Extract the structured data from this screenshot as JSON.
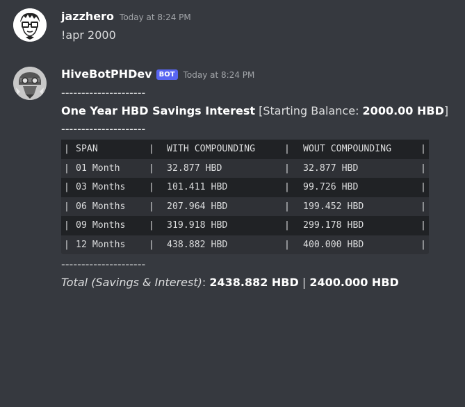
{
  "messages": [
    {
      "username": "jazzhero",
      "timestamp": "Today at 8:24 PM",
      "text": "!apr 2000"
    },
    {
      "username": "HiveBotPHDev",
      "bot_tag": "BOT",
      "timestamp": "Today at 8:24 PM",
      "divider": "---------------------",
      "title_bold": "One Year HBD Savings Interest",
      "title_rest": " [Starting Balance: ",
      "title_balance": "2000.00 HBD",
      "title_close": "]",
      "table": {
        "pipe": "|",
        "headers": [
          "SPAN",
          "WITH COMPOUNDING",
          "WOUT COMPOUNDING"
        ],
        "rows": [
          [
            "01 Month",
            "32.877 HBD",
            "32.877 HBD"
          ],
          [
            "03 Months",
            "101.411 HBD",
            "99.726 HBD"
          ],
          [
            "06 Months",
            "207.964 HBD",
            "199.452 HBD"
          ],
          [
            "09 Months",
            "319.918 HBD",
            "299.178 HBD"
          ],
          [
            "12 Months",
            "438.882 HBD",
            "400.000 HBD"
          ]
        ]
      },
      "total_label": "Total (Savings & Interest)",
      "total_colon": ": ",
      "total_with": "2438.882 HBD",
      "total_sep": " | ",
      "total_wout": "2400.000 HBD"
    }
  ],
  "colors": {
    "background": "#36393f",
    "bot_tag": "#5865f2",
    "code_bg": "#2f3136",
    "code_row_alt": "#202225"
  },
  "icons": [
    "user-avatar-jazzhero",
    "user-avatar-hivebot"
  ]
}
